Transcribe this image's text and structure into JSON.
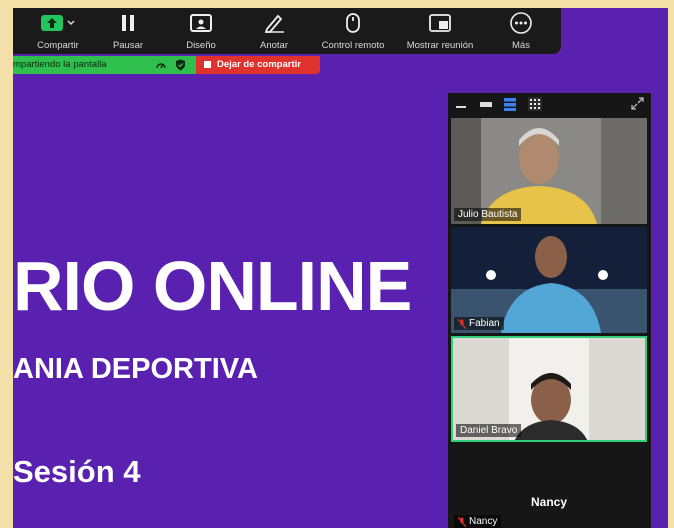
{
  "toolbar": {
    "items": [
      {
        "label": "Compartir",
        "icon": "share-screen-icon"
      },
      {
        "label": "Pausar",
        "icon": "pause-icon"
      },
      {
        "label": "Diseño",
        "icon": "layout-icon"
      },
      {
        "label": "Anotar",
        "icon": "annotate-icon"
      },
      {
        "label": "Control remoto",
        "icon": "remote-control-icon"
      },
      {
        "label": "Mostrar reunión",
        "icon": "show-meeting-icon"
      },
      {
        "label": "Más",
        "icon": "more-icon"
      }
    ]
  },
  "share_status": {
    "text": "mpartiendo la pantalla",
    "stop_label": "Dejar de compartir"
  },
  "slide": {
    "title": "RIO ONLINE",
    "subtitle": "ANIA DEPORTIVA",
    "session": "Sesión 4"
  },
  "participants": [
    {
      "name": "Julio Bautista",
      "muted": false
    },
    {
      "name": "Fabian",
      "muted": true
    },
    {
      "name": "Daniel Bravo",
      "muted": false,
      "active": true
    },
    {
      "name": "Nancy",
      "muted": true,
      "display": "Nancy"
    }
  ],
  "colors": {
    "slide_bg": "#5a21b0",
    "toolbar_bg": "#1a1a1a",
    "share_green": "#2fbf4c",
    "stop_red": "#e0322c",
    "active_border": "#2fd07a"
  }
}
